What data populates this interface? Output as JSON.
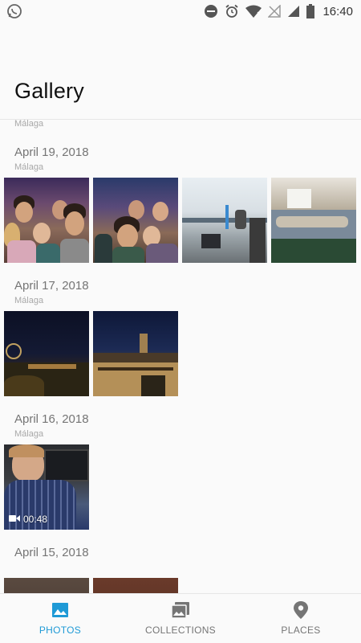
{
  "status_bar": {
    "time": "16:40",
    "icons": [
      "whatsapp-icon",
      "do-not-disturb-icon",
      "alarm-icon",
      "wifi-icon",
      "no-signal-icon",
      "cell-signal-icon",
      "battery-icon"
    ]
  },
  "header": {
    "title": "Gallery"
  },
  "peek": {
    "place": "Málaga"
  },
  "sections": [
    {
      "date": "April 19, 2018",
      "place": "Málaga",
      "items": [
        "photo",
        "photo",
        "photo",
        "photo"
      ]
    },
    {
      "date": "April 17, 2018",
      "place": "Málaga",
      "items": [
        "photo",
        "photo"
      ]
    },
    {
      "date": "April 16, 2018",
      "place": "Málaga",
      "items": [
        "video"
      ],
      "video_duration": "00:48"
    },
    {
      "date": "April 15, 2018",
      "place": "",
      "items": [
        "photo",
        "photo"
      ]
    }
  ],
  "bottom_nav": {
    "items": [
      {
        "label": "PHOTOS",
        "icon": "photos-icon",
        "active": true
      },
      {
        "label": "COLLECTIONS",
        "icon": "collections-icon",
        "active": false
      },
      {
        "label": "PLACES",
        "icon": "location-pin-icon",
        "active": false
      }
    ]
  },
  "colors": {
    "accent": "#1f9ad6",
    "background": "#fafafa",
    "muted_text": "#757575"
  }
}
